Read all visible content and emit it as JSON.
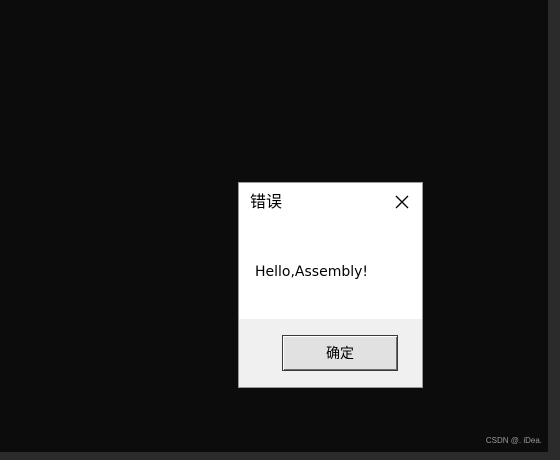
{
  "dialog": {
    "title": "错误",
    "message": "Hello,Assembly!",
    "ok_label": "确定",
    "close_icon": "close-icon"
  },
  "watermark": "CSDN @. iDea.",
  "colors": {
    "console_bg": "#0c0c0c",
    "dialog_bg": "#ffffff",
    "footer_bg": "#f0f0f0"
  }
}
